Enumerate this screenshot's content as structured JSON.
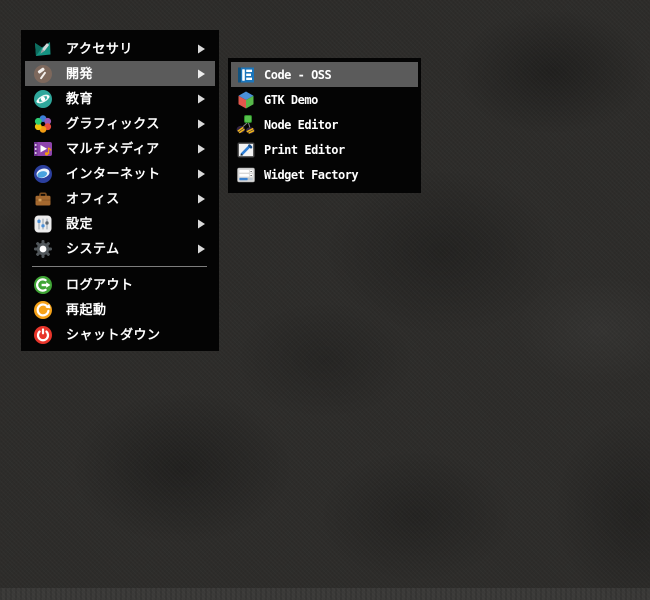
{
  "desktop": {
    "wallpaper": "dark damask leaf fabric",
    "colors": {
      "base": "#2d2c2a",
      "menu_bg": "#040404",
      "highlight": "#5b5b5b",
      "text": "#ffffff",
      "separator": "#7d7d7d",
      "arrow": "#d9d9d9"
    }
  },
  "main_menu": {
    "items": [
      {
        "label": "アクセサリ",
        "icon": "accessories-icon",
        "has_submenu": true
      },
      {
        "label": "開発",
        "icon": "development-icon",
        "has_submenu": true,
        "highlighted": true
      },
      {
        "label": "教育",
        "icon": "education-icon",
        "has_submenu": true
      },
      {
        "label": "グラフィックス",
        "icon": "graphics-icon",
        "has_submenu": true
      },
      {
        "label": "マルチメディア",
        "icon": "multimedia-icon",
        "has_submenu": true
      },
      {
        "label": "インターネット",
        "icon": "internet-icon",
        "has_submenu": true
      },
      {
        "label": "オフィス",
        "icon": "office-icon",
        "has_submenu": true
      },
      {
        "label": "設定",
        "icon": "settings-icon",
        "has_submenu": true
      },
      {
        "label": "システム",
        "icon": "system-icon",
        "has_submenu": true
      }
    ],
    "actions": [
      {
        "label": "ログアウト",
        "icon": "logout-icon"
      },
      {
        "label": "再起動",
        "icon": "restart-icon"
      },
      {
        "label": "シャットダウン",
        "icon": "shutdown-icon"
      }
    ]
  },
  "submenu": {
    "parent": "開発",
    "items": [
      {
        "label": "Code - OSS",
        "icon": "code-oss-icon",
        "highlighted": true
      },
      {
        "label": "GTK Demo",
        "icon": "gtk-demo-icon"
      },
      {
        "label": "Node Editor",
        "icon": "node-editor-icon"
      },
      {
        "label": "Print Editor",
        "icon": "print-editor-icon"
      },
      {
        "label": "Widget Factory",
        "icon": "widget-factory-icon"
      }
    ]
  }
}
